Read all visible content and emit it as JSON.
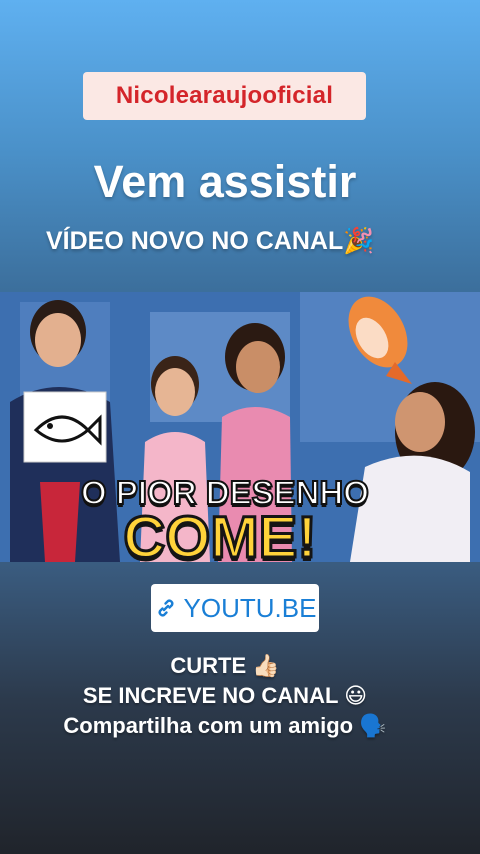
{
  "channel_tag": "Nicolearaujooficial",
  "headline": "Vem assistir",
  "subheadline": "VÍDEO NOVO NO CANAL",
  "subheadline_emoji": "🎉",
  "video": {
    "title_line1": "O PIOR DESENHO",
    "title_line2": "COME!"
  },
  "link": {
    "icon": "link-icon",
    "label": "YOUTU.BE"
  },
  "cta": {
    "line1_text": "CURTE",
    "line1_emoji": "👍🏻",
    "line2_text": "SE INCREVE NO CANAL",
    "line2_emoji": "😃",
    "line3_text": "Compartilha com um amigo",
    "line3_emoji": "🗣️"
  },
  "colors": {
    "tag_text": "#d4252a",
    "tag_bg": "#fbe8e4",
    "title_yellow": "#ffd33a",
    "link_blue": "#1a7fd6"
  }
}
